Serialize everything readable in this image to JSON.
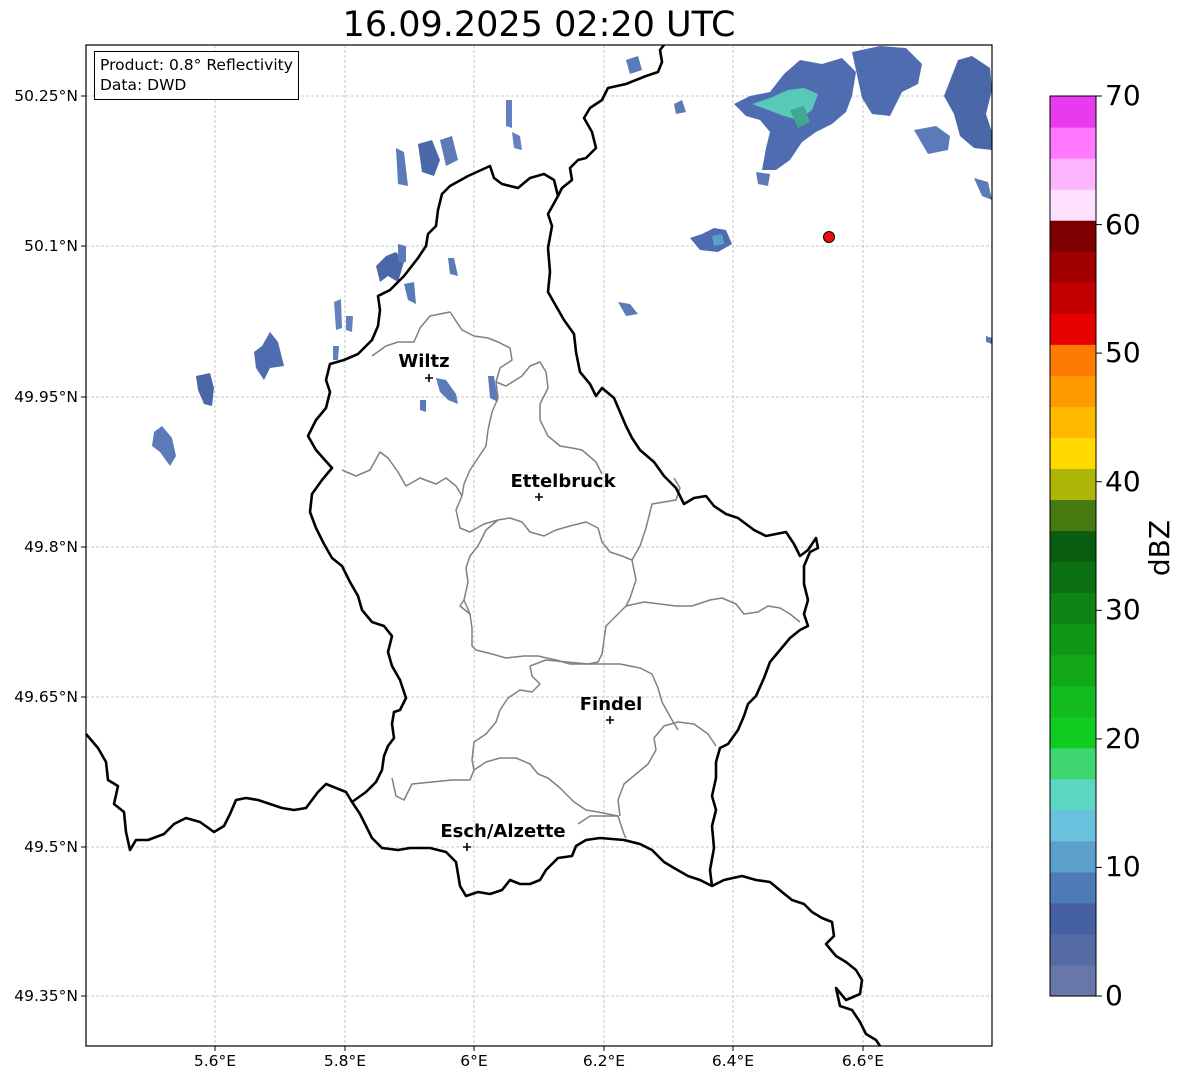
{
  "title": "16.09.2025 02:20 UTC",
  "info": {
    "product": "Product: 0.8° Reflectivity",
    "data": "Data: DWD"
  },
  "latitude_ticks": [
    "50.25°N",
    "50.1°N",
    "49.95°N",
    "49.8°N",
    "49.65°N",
    "49.5°N",
    "49.35°N"
  ],
  "longitude_ticks": [
    "5.6°E",
    "5.8°E",
    "6°E",
    "6.2°E",
    "6.4°E",
    "6.6°E"
  ],
  "cities": [
    {
      "name": "Wiltz",
      "lon": 5.93,
      "lat": 49.967
    },
    {
      "name": "Ettelbruck",
      "lon": 6.1,
      "lat": 49.847
    },
    {
      "name": "Findel",
      "lon": 6.21,
      "lat": 49.624
    },
    {
      "name": "Esch/Alzette",
      "lon": 5.99,
      "lat": 49.499
    }
  ],
  "marker": {
    "lon": 6.55,
    "lat": 50.109,
    "color": "#e81010"
  },
  "colorbar": {
    "label": "dBZ",
    "ticks": [
      "0",
      "10",
      "20",
      "30",
      "40",
      "50",
      "60",
      "70"
    ],
    "min": 0,
    "max": 70,
    "colors": [
      "#6777a8",
      "#546ca3",
      "#4560a3",
      "#4c7bb5",
      "#5aa0cb",
      "#68c2dd",
      "#5dd6c2",
      "#3dd670",
      "#10cc20",
      "#12bc1e",
      "#12a818",
      "#0f9816",
      "#0e8414",
      "#0b7012",
      "#0a5c0e",
      "#467a10",
      "#adb40a",
      "#ffd900",
      "#ffb800",
      "#ff9a00",
      "#ff7a00",
      "#e60000",
      "#c20000",
      "#a20000",
      "#7d0000",
      "#ffe0ff",
      "#ffb4ff",
      "#ff78ff",
      "#e83aee"
    ]
  },
  "colors": {
    "border": "#000000",
    "cantons": "#808080",
    "grid": "#b8b8b8",
    "radar_light": "#5a7ab8",
    "radar_mid": "#4a67a8",
    "radar_high": "#58c8b8"
  }
}
